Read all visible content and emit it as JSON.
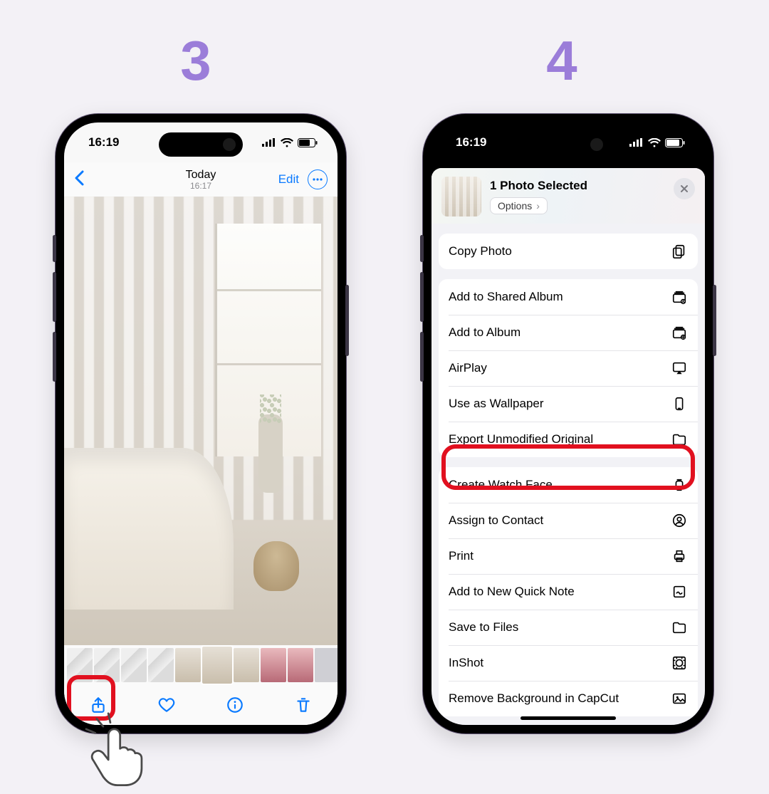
{
  "steps": {
    "left": "3",
    "right": "4"
  },
  "status": {
    "time": "16:19"
  },
  "left": {
    "nav_title": "Today",
    "nav_time": "16:17",
    "edit": "Edit"
  },
  "right": {
    "selected": "1 Photo Selected",
    "options": "Options",
    "groups": [
      [
        {
          "label": "Copy Photo",
          "icon": "copy"
        }
      ],
      [
        {
          "label": "Add to Shared Album",
          "icon": "shared-album"
        },
        {
          "label": "Add to Album",
          "icon": "album"
        },
        {
          "label": "AirPlay",
          "icon": "airplay"
        },
        {
          "label": "Use as Wallpaper",
          "icon": "wallpaper"
        },
        {
          "label": "Export Unmodified Original",
          "icon": "folder"
        }
      ],
      [
        {
          "label": "Create Watch Face",
          "icon": "watch"
        },
        {
          "label": "Assign to Contact",
          "icon": "contact"
        },
        {
          "label": "Print",
          "icon": "print"
        },
        {
          "label": "Add to New Quick Note",
          "icon": "note"
        },
        {
          "label": "Save to Files",
          "icon": "folder"
        },
        {
          "label": "InShot",
          "icon": "inshot"
        },
        {
          "label": "Remove Background in CapCut",
          "icon": "image"
        }
      ]
    ]
  }
}
